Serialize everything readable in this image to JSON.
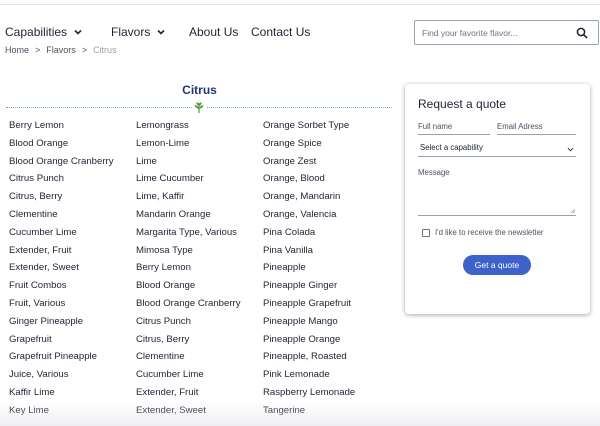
{
  "nav": {
    "capabilities": "Capabilities",
    "flavors": "Flavors",
    "about": "About Us",
    "contact": "Contact Us",
    "search_placeholder": "Find your favorite flavor..."
  },
  "breadcrumb": {
    "home": "Home",
    "sep": ">",
    "flavors": "Flavors",
    "current": "Citrus"
  },
  "section": {
    "title": "Citrus",
    "accent_color": "#4c9a3c",
    "divider_color": "#6fb3c9"
  },
  "flavors": {
    "column_1": [
      "Berry Lemon",
      "Blood Orange",
      "Blood Orange Cranberry",
      "Citrus Punch",
      "Citrus, Berry",
      "Clementine",
      "Cucumber Lime",
      "Extender, Fruit",
      "Extender, Sweet",
      "Fruit Combos",
      "Fruit, Various",
      "Ginger Pineapple",
      "Grapefruit",
      "Grapefruit Pineapple",
      "Juice, Various",
      "Kaffir Lime",
      "Key Lime"
    ],
    "column_2": [
      "Lemongrass",
      "Lemon-Lime",
      "Lime",
      "Lime Cucumber",
      "Lime, Kaffir",
      "Mandarin Orange",
      "Margarita Type, Various",
      "Mimosa Type",
      "Berry Lemon",
      "Blood Orange",
      "Blood Orange Cranberry",
      "Citrus Punch",
      "Citrus, Berry",
      "Clementine",
      "Cucumber Lime",
      "Extender, Fruit",
      "Extender, Sweet"
    ],
    "column_3": [
      "Orange Sorbet Type",
      "Orange Spice",
      "Orange Zest",
      "Orange, Blood",
      "Orange, Mandarin",
      "Orange, Valencia",
      "Pina Colada",
      "Pina Vanilla",
      "Pineapple",
      "Pineapple Ginger",
      "Pineapple Grapefruit",
      "Pineapple Mango",
      "Pineapple Orange",
      "Pineapple, Roasted",
      "Pink Lemonade",
      "Raspberry Lemonade",
      "Tangerine"
    ]
  },
  "quote": {
    "title": "Request a quote",
    "full_name": "Full name",
    "email": "Email Adress",
    "capability": "Select a capability",
    "message": "Message",
    "newsletter": "I'd like to receive the newsletter",
    "button": "Get a quote",
    "button_color": "#3d62c9"
  },
  "icons": {
    "search": "search-icon",
    "chevron": "chevron-down-icon",
    "leaf": "leaf-icon"
  }
}
